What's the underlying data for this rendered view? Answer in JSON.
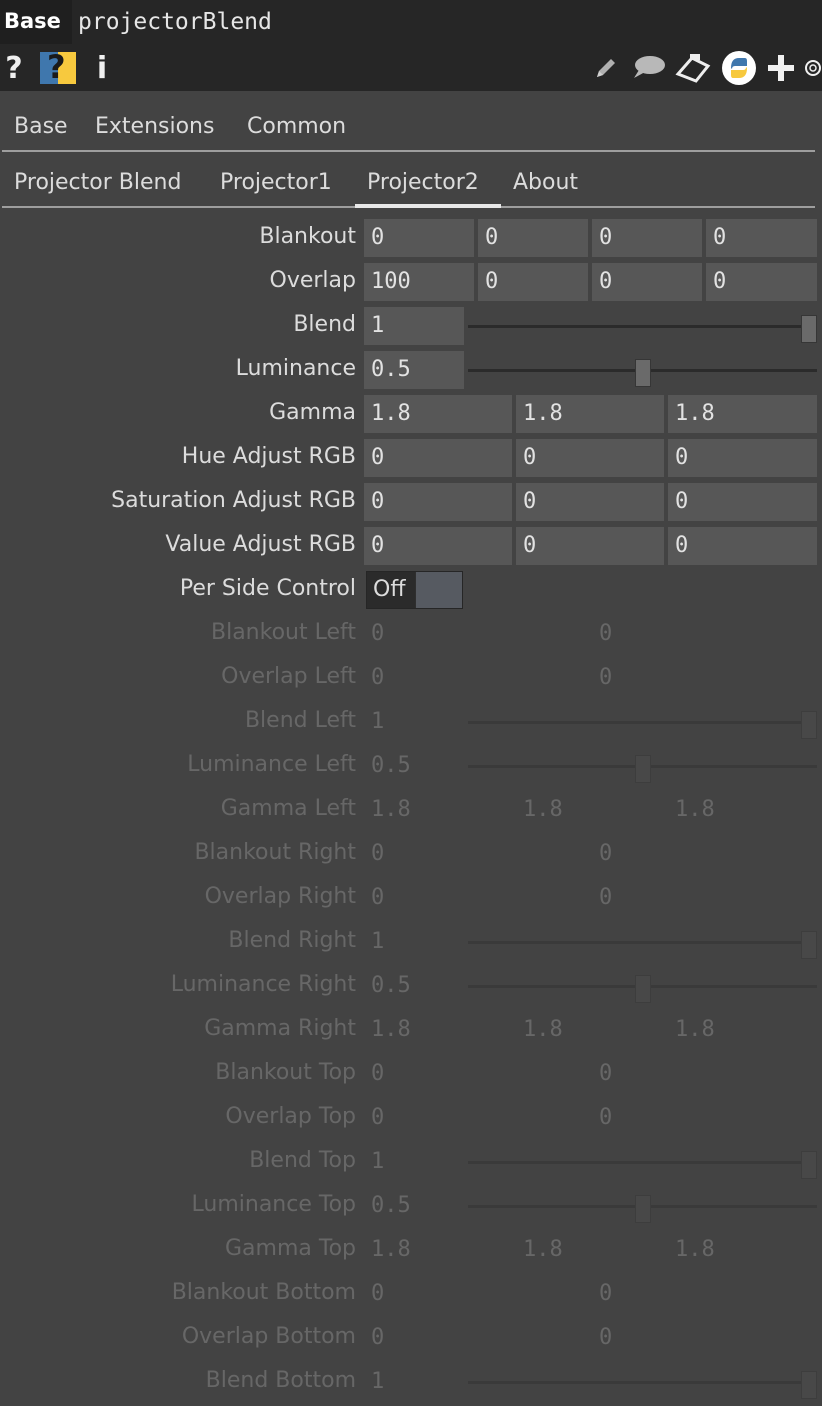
{
  "header": {
    "op_type": "Base",
    "op_name": "projectorBlend"
  },
  "toolbar": {
    "help_glyph": "?",
    "help_python_glyph": "?",
    "info_glyph": "i",
    "icons": [
      "help-icon",
      "python-help-icon",
      "info-icon",
      "edit-icon",
      "comment-icon",
      "clipboard-icon",
      "python-icon",
      "add-icon",
      "settings-icon"
    ]
  },
  "page_tabs": [
    "Base",
    "Extensions",
    "Common"
  ],
  "custom_tabs": [
    "Projector Blend",
    "Projector1",
    "Projector2",
    "About"
  ],
  "active_custom_tab": "Projector2",
  "params": {
    "blankout": {
      "label": "Blankout",
      "values": [
        "0",
        "0",
        "0",
        "0"
      ]
    },
    "overlap": {
      "label": "Overlap",
      "values": [
        "100",
        "0",
        "0",
        "0"
      ]
    },
    "blend": {
      "label": "Blend",
      "value": "1",
      "slider_fraction": 1.0
    },
    "luminance": {
      "label": "Luminance",
      "value": "0.5",
      "slider_fraction": 0.5
    },
    "gamma": {
      "label": "Gamma",
      "values": [
        "1.8",
        "1.8",
        "1.8"
      ]
    },
    "hue": {
      "label": "Hue Adjust RGB",
      "values": [
        "0",
        "0",
        "0"
      ]
    },
    "saturation": {
      "label": "Saturation Adjust RGB",
      "values": [
        "0",
        "0",
        "0"
      ]
    },
    "value": {
      "label": "Value Adjust RGB",
      "values": [
        "0",
        "0",
        "0"
      ]
    },
    "per_side": {
      "label": "Per Side Control",
      "value": "Off"
    },
    "blankout_left": {
      "label": "Blankout Left",
      "values": [
        "0",
        "0"
      ]
    },
    "overlap_left": {
      "label": "Overlap Left",
      "values": [
        "0",
        "0"
      ]
    },
    "blend_left": {
      "label": "Blend Left",
      "value": "1",
      "slider_fraction": 1.0
    },
    "luminance_left": {
      "label": "Luminance Left",
      "value": "0.5",
      "slider_fraction": 0.5
    },
    "gamma_left": {
      "label": "Gamma Left",
      "values": [
        "1.8",
        "1.8",
        "1.8"
      ]
    },
    "blankout_right": {
      "label": "Blankout Right",
      "values": [
        "0",
        "0"
      ]
    },
    "overlap_right": {
      "label": "Overlap Right",
      "values": [
        "0",
        "0"
      ]
    },
    "blend_right": {
      "label": "Blend Right",
      "value": "1",
      "slider_fraction": 1.0
    },
    "luminance_right": {
      "label": "Luminance Right",
      "value": "0.5",
      "slider_fraction": 0.5
    },
    "gamma_right": {
      "label": "Gamma Right",
      "values": [
        "1.8",
        "1.8",
        "1.8"
      ]
    },
    "blankout_top": {
      "label": "Blankout Top",
      "values": [
        "0",
        "0"
      ]
    },
    "overlap_top": {
      "label": "Overlap Top",
      "values": [
        "0",
        "0"
      ]
    },
    "blend_top": {
      "label": "Blend Top",
      "value": "1",
      "slider_fraction": 1.0
    },
    "luminance_top": {
      "label": "Luminance Top",
      "value": "0.5",
      "slider_fraction": 0.5
    },
    "gamma_top": {
      "label": "Gamma Top",
      "values": [
        "1.8",
        "1.8",
        "1.8"
      ]
    },
    "blankout_bottom": {
      "label": "Blankout Bottom",
      "values": [
        "0",
        "0"
      ]
    },
    "overlap_bottom": {
      "label": "Overlap Bottom",
      "values": [
        "0",
        "0"
      ]
    },
    "blend_bottom": {
      "label": "Blend Bottom",
      "value": "1",
      "slider_fraction": 1.0
    }
  },
  "colors": {
    "background": "#434343",
    "field": "#575757",
    "disabled_text": "#676767",
    "python_yellow": "#f7c93e",
    "python_blue": "#3f77ad"
  }
}
